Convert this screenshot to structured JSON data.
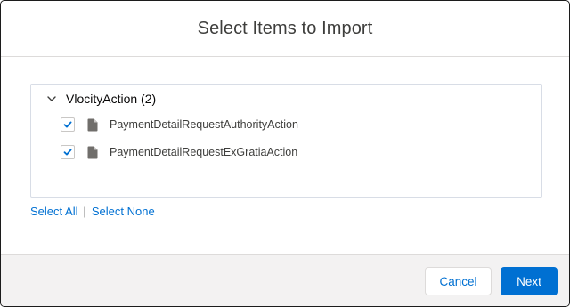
{
  "modal": {
    "title": "Select Items to Import"
  },
  "tree": {
    "group_label": "VlocityAction (2)",
    "expanded": true,
    "items": [
      {
        "label": "PaymentDetailRequestAuthorityAction",
        "checked": true,
        "icon": "file-icon"
      },
      {
        "label": "PaymentDetailRequestExGratiaAction",
        "checked": true,
        "icon": "file-icon"
      }
    ]
  },
  "links": {
    "select_all": "Select All",
    "separator": "|",
    "select_none": "Select None"
  },
  "footer": {
    "cancel_label": "Cancel",
    "next_label": "Next"
  },
  "colors": {
    "brand": "#0070d2",
    "footer_bg": "#f3f2f2",
    "border": "#dddbda"
  }
}
